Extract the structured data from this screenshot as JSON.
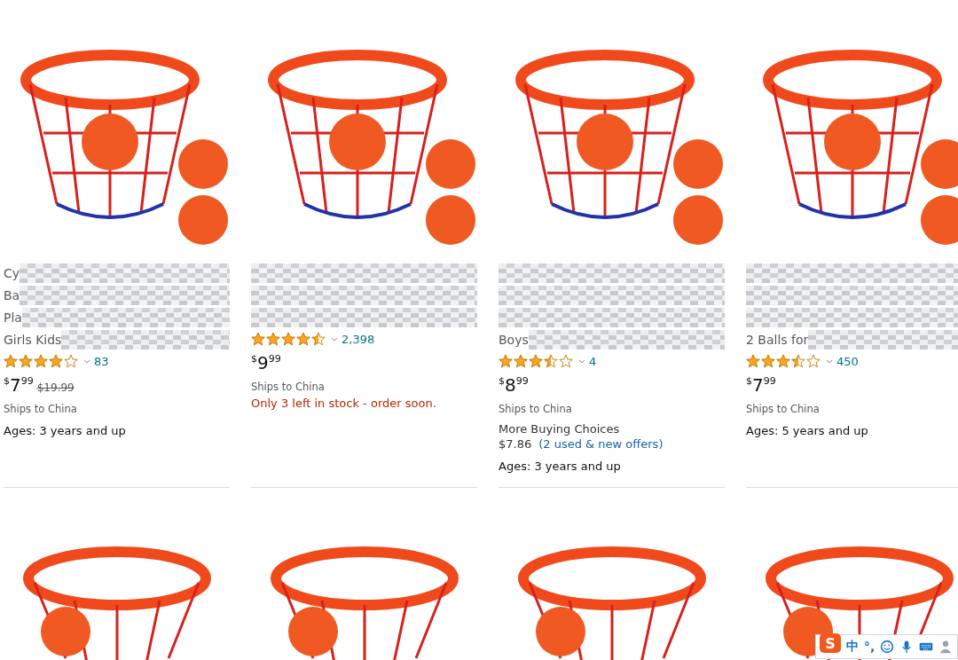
{
  "products": [
    {
      "title_lines": [
        {
          "text": "Cy",
          "blurred": true
        },
        {
          "text": "Ba",
          "blurred": true
        },
        {
          "text": "Pla",
          "blurred": true
        },
        {
          "text": "Girls Kids",
          "blurred": true
        }
      ],
      "stars": 4,
      "rating_count": "83",
      "price": {
        "symbol": "$",
        "whole": "7",
        "fraction": "99"
      },
      "list_price": "$19.99",
      "shipping": "Ships to China",
      "ages": "Ages: 3 years and up"
    },
    {
      "title_lines": [
        {
          "blurred": true
        },
        {
          "blurred": true
        },
        {
          "blurred": true
        }
      ],
      "stars": 4.5,
      "rating_count": "2,398",
      "price": {
        "symbol": "$",
        "whole": "9",
        "fraction": "99"
      },
      "shipping": "Ships to China",
      "stock_note": "Only 3 left in stock - order soon."
    },
    {
      "title_lines": [
        {
          "blurred": true
        },
        {
          "blurred": true
        },
        {
          "blurred": true
        },
        {
          "text": "Boys",
          "blurred": true
        }
      ],
      "stars": 3.5,
      "rating_count": "4",
      "price": {
        "symbol": "$",
        "whole": "8",
        "fraction": "99"
      },
      "shipping": "Ships to China",
      "more_buying": {
        "label": "More Buying Choices",
        "price": "$7.86",
        "offers": "(2 used & new offers)"
      },
      "ages": "Ages: 3 years and up"
    },
    {
      "title_lines": [
        {
          "blurred": true
        },
        {
          "blurred": true
        },
        {
          "blurred": true
        },
        {
          "text": "2 Balls for",
          "blurred": true
        }
      ],
      "stars": 3.5,
      "rating_count": "450",
      "price": {
        "symbol": "$",
        "whole": "7",
        "fraction": "99"
      },
      "shipping": "Ships to China",
      "ages": "Ages: 5 years and up"
    }
  ],
  "next_row": [
    {
      "kind": "photo"
    },
    {
      "kind": "photo"
    },
    {
      "kind": "photo"
    },
    {
      "kind": "photo"
    }
  ],
  "ime_toolbar": {
    "logo": "S",
    "language": "中",
    "punctuation": "°,"
  }
}
